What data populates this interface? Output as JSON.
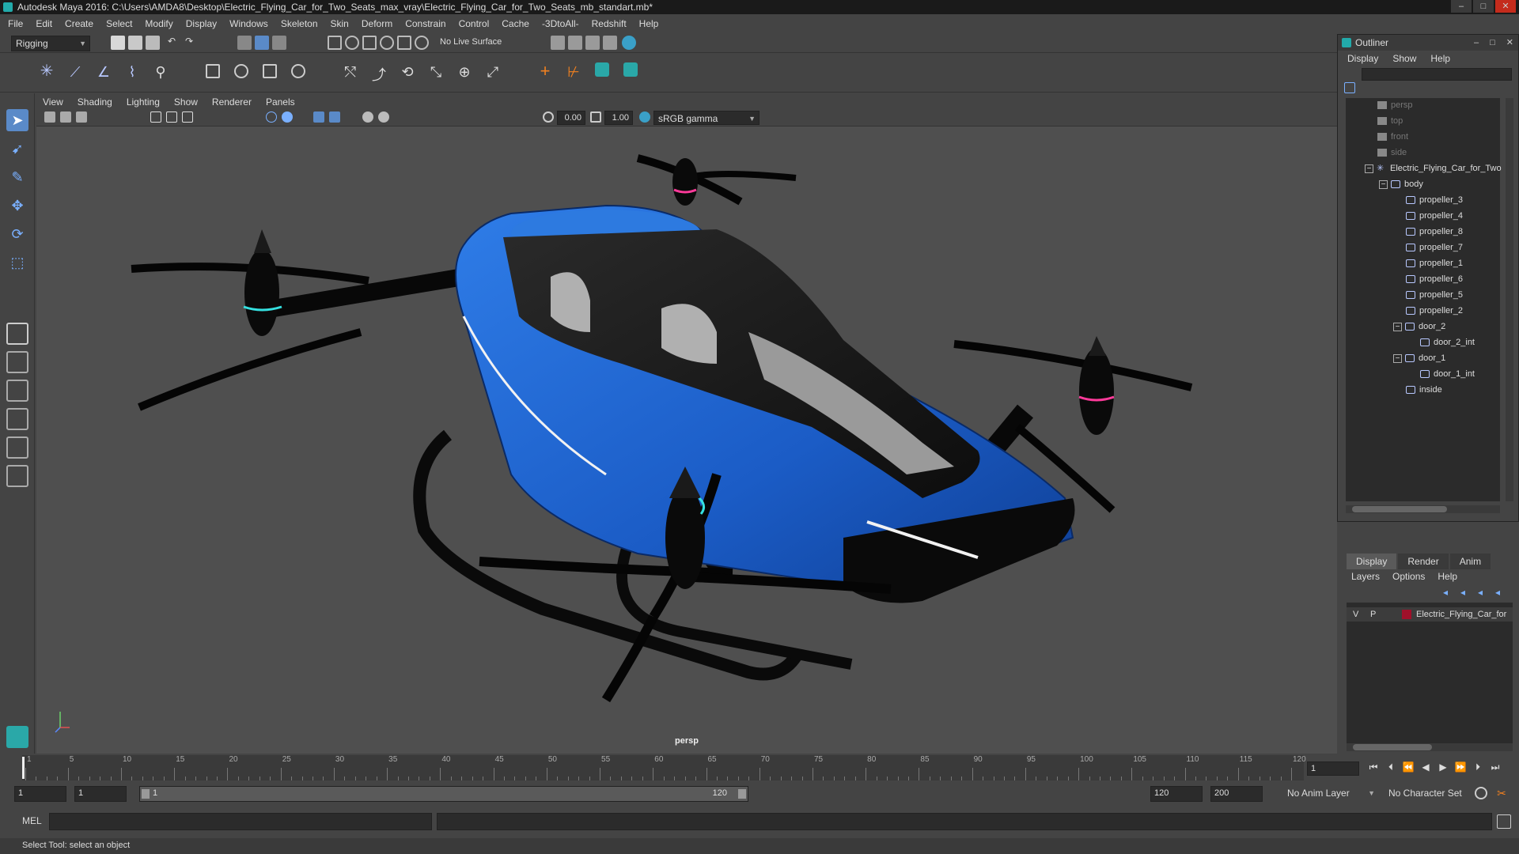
{
  "window": {
    "title": "Autodesk Maya 2016: C:\\Users\\AMDA8\\Desktop\\Electric_Flying_Car_for_Two_Seats_max_vray\\Electric_Flying_Car_for_Two_Seats_mb_standart.mb*",
    "min": "–",
    "max": "□",
    "close": "✕"
  },
  "menubar": [
    "File",
    "Edit",
    "Create",
    "Select",
    "Modify",
    "Display",
    "Windows",
    "Skeleton",
    "Skin",
    "Deform",
    "Constrain",
    "Control",
    "Cache",
    "-3DtoAll-",
    "Redshift",
    "Help"
  ],
  "shelf": {
    "mode": "Rigging",
    "live_surface": "No Live Surface"
  },
  "viewport": {
    "menu": [
      "View",
      "Shading",
      "Lighting",
      "Show",
      "Renderer",
      "Panels"
    ],
    "exposure": "0.00",
    "gamma": "1.00",
    "color_space": "sRGB gamma",
    "camera": "persp"
  },
  "outliner": {
    "title": "Outliner",
    "menu": [
      "Display",
      "Show",
      "Help"
    ],
    "items": [
      {
        "label": "persp",
        "indent": 0,
        "dim": true,
        "type": "camera"
      },
      {
        "label": "top",
        "indent": 0,
        "dim": true,
        "type": "camera"
      },
      {
        "label": "front",
        "indent": 0,
        "dim": true,
        "type": "camera"
      },
      {
        "label": "side",
        "indent": 0,
        "dim": true,
        "type": "camera"
      },
      {
        "label": "Electric_Flying_Car_for_Two",
        "indent": 0,
        "dim": false,
        "type": "group",
        "expander": "−"
      },
      {
        "label": "body",
        "indent": 1,
        "dim": false,
        "type": "mesh",
        "expander": "−"
      },
      {
        "label": "propeller_3",
        "indent": 2,
        "dim": false,
        "type": "mesh"
      },
      {
        "label": "propeller_4",
        "indent": 2,
        "dim": false,
        "type": "mesh"
      },
      {
        "label": "propeller_8",
        "indent": 2,
        "dim": false,
        "type": "mesh"
      },
      {
        "label": "propeller_7",
        "indent": 2,
        "dim": false,
        "type": "mesh"
      },
      {
        "label": "propeller_1",
        "indent": 2,
        "dim": false,
        "type": "mesh"
      },
      {
        "label": "propeller_6",
        "indent": 2,
        "dim": false,
        "type": "mesh"
      },
      {
        "label": "propeller_5",
        "indent": 2,
        "dim": false,
        "type": "mesh"
      },
      {
        "label": "propeller_2",
        "indent": 2,
        "dim": false,
        "type": "mesh"
      },
      {
        "label": "door_2",
        "indent": 2,
        "dim": false,
        "type": "mesh",
        "expander": "−"
      },
      {
        "label": "door_2_int",
        "indent": 3,
        "dim": false,
        "type": "mesh"
      },
      {
        "label": "door_1",
        "indent": 2,
        "dim": false,
        "type": "mesh",
        "expander": "−"
      },
      {
        "label": "door_1_int",
        "indent": 3,
        "dim": false,
        "type": "mesh"
      },
      {
        "label": "inside",
        "indent": 2,
        "dim": false,
        "type": "mesh"
      }
    ]
  },
  "layers": {
    "tabs": [
      "Display",
      "Render",
      "Anim"
    ],
    "active_tab": "Display",
    "menu": [
      "Layers",
      "Options",
      "Help"
    ],
    "row": {
      "v": "V",
      "p": "P",
      "name": "Electric_Flying_Car_for",
      "color": "#a0102a"
    }
  },
  "timeline": {
    "ticks": [
      "1",
      "5",
      "10",
      "15",
      "20",
      "25",
      "30",
      "35",
      "40",
      "45",
      "50",
      "55",
      "60",
      "65",
      "70",
      "75",
      "80",
      "85",
      "90",
      "95",
      "100",
      "105",
      "110",
      "115",
      "120"
    ],
    "current_frame": "1"
  },
  "range": {
    "start": "1",
    "playback_start": "1",
    "slider_start": "1",
    "slider_end": "120",
    "playback_end": "120",
    "end": "200",
    "anim_layer": "No Anim Layer",
    "character_set": "No Character Set"
  },
  "command": {
    "label": "MEL"
  },
  "status": "Select Tool: select an object",
  "colors": {
    "body_blue": "#1f5fc8",
    "accent_cyan": "#35e0e0",
    "accent_pink": "#ff3a9a"
  }
}
